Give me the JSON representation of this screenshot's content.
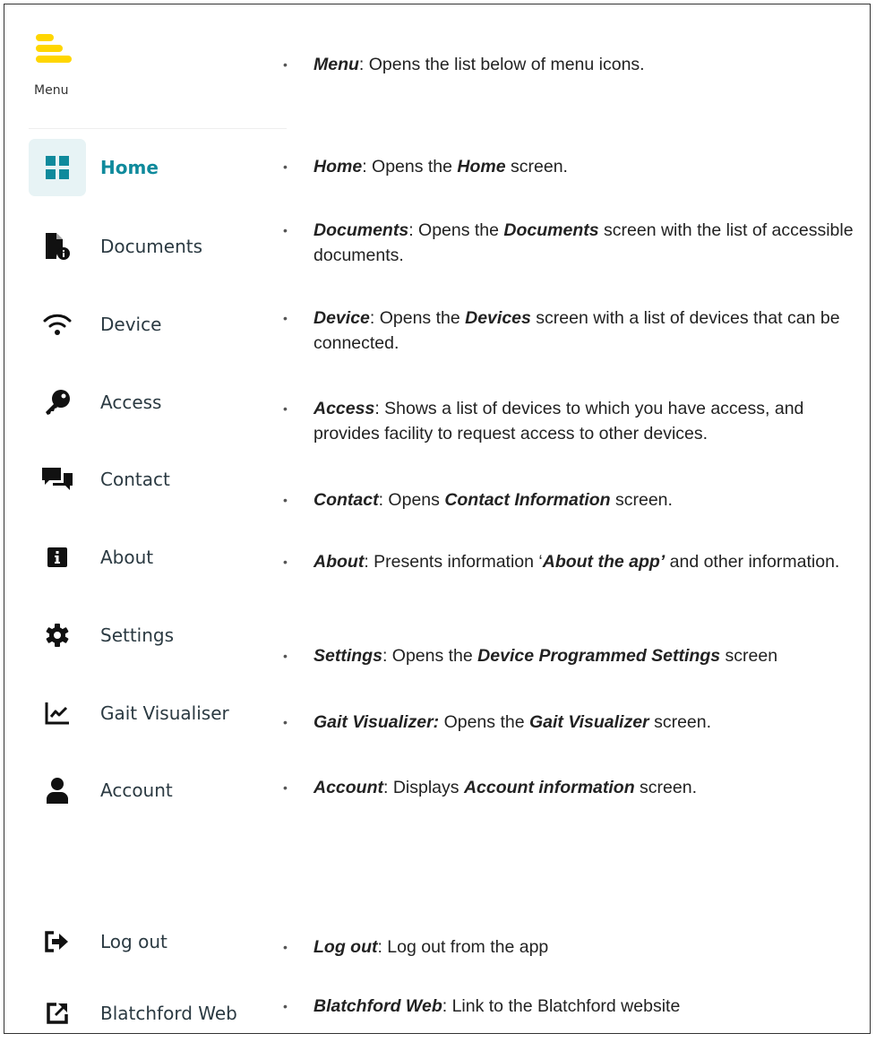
{
  "menu": {
    "label": "Menu",
    "brand_color": "#ffd600"
  },
  "colors": {
    "active": "#0f8a9c",
    "active_bg": "#e7f3f5",
    "icon": "#111111"
  },
  "nav": [
    {
      "id": "home",
      "label": "Home",
      "icon": "grid-icon",
      "active": true
    },
    {
      "id": "documents",
      "label": "Documents",
      "icon": "document-info-icon"
    },
    {
      "id": "device",
      "label": "Device",
      "icon": "wifi-icon"
    },
    {
      "id": "access",
      "label": "Access",
      "icon": "key-icon"
    },
    {
      "id": "contact",
      "label": "Contact",
      "icon": "chat-icon"
    },
    {
      "id": "about",
      "label": "About",
      "icon": "info-icon"
    },
    {
      "id": "settings",
      "label": "Settings",
      "icon": "gear-icon"
    },
    {
      "id": "gait",
      "label": "Gait Visualiser",
      "icon": "chart-line-icon"
    },
    {
      "id": "account",
      "label": "Account",
      "icon": "user-icon"
    },
    {
      "id": "logout",
      "label": "Log out",
      "icon": "logout-icon"
    },
    {
      "id": "web",
      "label": "Blatchford Web",
      "icon": "external-link-icon"
    }
  ],
  "descriptions": [
    {
      "term": "Menu",
      "parts": [
        ": Opens the list below of menu icons."
      ]
    },
    {
      "term": "Home",
      "parts": [
        ": Opens the ",
        "Home",
        " screen."
      ]
    },
    {
      "term": "Documents",
      "parts": [
        ": Opens the ",
        "Documents",
        " screen with the list of accessible documents."
      ]
    },
    {
      "term": "Device",
      "parts": [
        ": Opens the ",
        "Devices",
        " screen with a list of devices that can be connected."
      ]
    },
    {
      "term": "Access",
      "parts": [
        ": Shows a list of devices to which you have access, and provides facility to request access to other devices."
      ]
    },
    {
      "term": "Contact",
      "parts": [
        ": Opens ",
        "Contact Information",
        " screen."
      ]
    },
    {
      "term": "About",
      "parts": [
        ": Presents information ‘",
        "About the app’",
        " and other information."
      ]
    },
    {
      "term": "Settings",
      "parts": [
        ": Opens the ",
        "Device Programmed Settings",
        " screen"
      ]
    },
    {
      "term": "Gait Visualizer:",
      "parts": [
        " Opens the ",
        "Gait Visualizer",
        " screen."
      ]
    },
    {
      "term": "Account",
      "parts": [
        ": Displays ",
        "Account information",
        " screen."
      ]
    },
    {
      "term": "Log out",
      "parts": [
        ": Log out from the app"
      ]
    },
    {
      "term": "Blatchford Web",
      "parts": [
        ": Link to the Blatchford website"
      ]
    }
  ]
}
